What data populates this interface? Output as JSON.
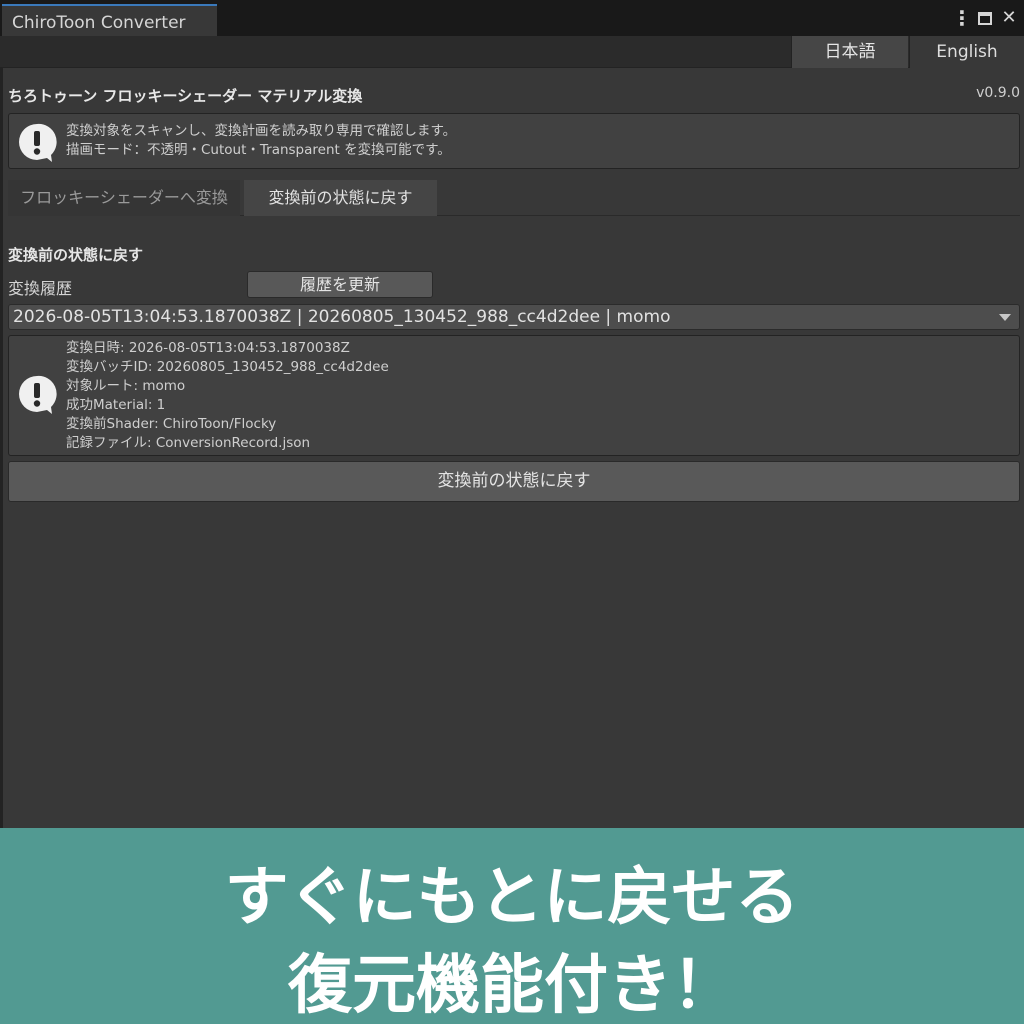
{
  "window": {
    "tab_title": "ChiroToon Converter",
    "controls": {
      "menu_glyph": "⋮",
      "close_glyph": "✕"
    }
  },
  "language": {
    "japanese": "日本語",
    "english": "English",
    "selected": "japanese"
  },
  "header": {
    "title": "ちろトゥーン フロッキーシェーダー マテリアル変換",
    "version": "v0.9.0"
  },
  "info_box": {
    "icon": "alert-icon",
    "lines": [
      "変換対象をスキャンし、変換計画を読み取り専用で確認します。",
      "描画モード：不透明・Cutout・Transparent を変換可能です。"
    ]
  },
  "tabs": [
    {
      "label": "フロッキーシェーダーへ変換",
      "active": false
    },
    {
      "label": "変換前の状態に戻す",
      "active": true
    }
  ],
  "restore": {
    "heading": "変換前の状態に戻す",
    "history_label": "変換履歴",
    "refresh_button": "履歴を更新",
    "selected_record": "2026-08-05T13:04:53.1870038Z | 20260805_130452_988_cc4d2dee | momo",
    "details": [
      "変換日時: 2026-08-05T13:04:53.1870038Z",
      "変換バッチID: 20260805_130452_988_cc4d2dee",
      "対象ルート: momo",
      "成功Material: 1",
      "変換前Shader: ChiroToon/Flocky",
      "記録ファイル: ConversionRecord.json"
    ],
    "restore_button": "変換前の状態に戻す"
  },
  "banner": {
    "line1": "すぐにもとに戻せる",
    "line2": "復元機能付き！"
  },
  "colors": {
    "accent_tab": "#3a79bb",
    "banner_bg": "#529a92",
    "panel_bg": "#383838"
  }
}
